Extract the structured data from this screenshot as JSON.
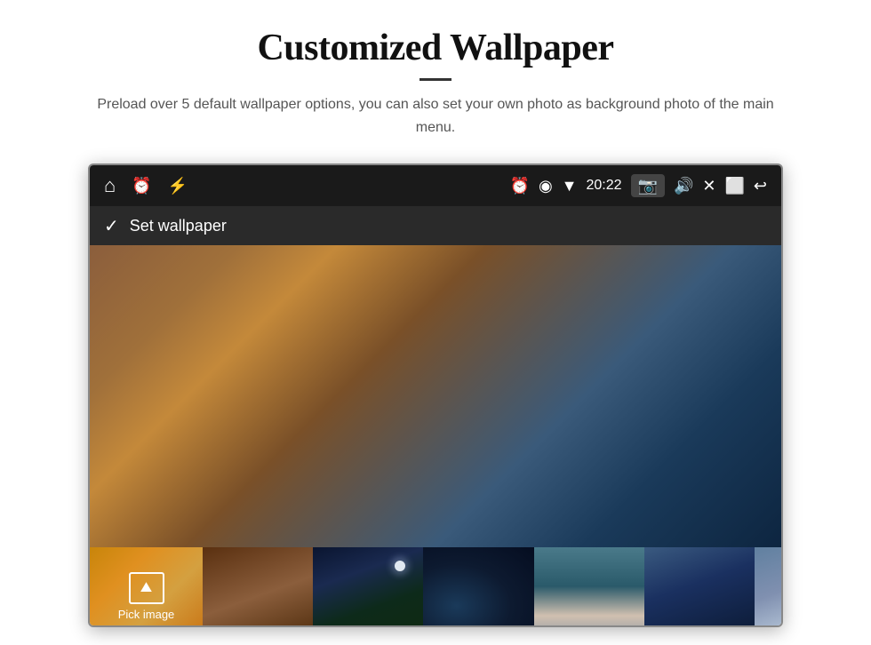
{
  "header": {
    "title": "Customized Wallpaper",
    "divider": true,
    "subtitle": "Preload over 5 default wallpaper options, you can also set your own photo as background photo of the main menu."
  },
  "device": {
    "statusBar": {
      "leftIcons": [
        "home",
        "alarm",
        "usb"
      ],
      "rightIcons": [
        "alarm",
        "location",
        "wifi",
        "time",
        "camera",
        "volume",
        "close",
        "window",
        "back"
      ],
      "time": "20:22"
    },
    "toolbar": {
      "label": "Set wallpaper",
      "checkIcon": "✓"
    },
    "thumbnails": [
      {
        "id": "pick",
        "label": "Pick image"
      },
      {
        "id": "thumb1",
        "label": ""
      },
      {
        "id": "thumb2",
        "label": ""
      },
      {
        "id": "thumb3",
        "label": ""
      },
      {
        "id": "thumb4",
        "label": ""
      },
      {
        "id": "thumb5",
        "label": ""
      }
    ]
  }
}
